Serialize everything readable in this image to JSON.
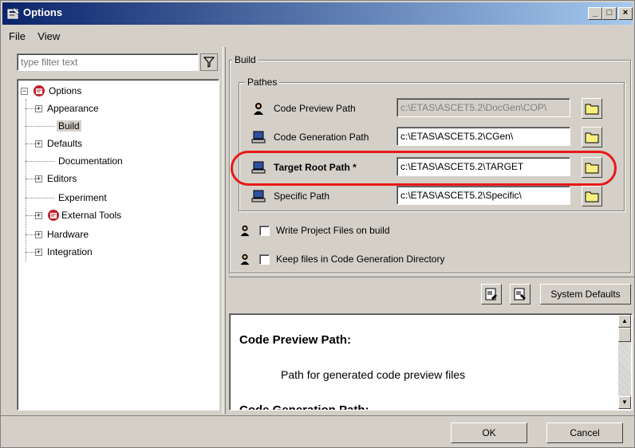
{
  "window": {
    "title": "Options",
    "controls": {
      "minimize": "_",
      "maximize": "□",
      "close": "×"
    }
  },
  "menu": [
    "File",
    "View"
  ],
  "filter": {
    "placeholder": "type filter text",
    "icon": "filter-icon"
  },
  "tree": {
    "root": "Options",
    "items": [
      {
        "label": "Appearance",
        "expandable": true
      },
      {
        "label": "Build",
        "expandable": false,
        "selected": true
      },
      {
        "label": "Defaults",
        "expandable": true
      },
      {
        "label": "Documentation",
        "expandable": false
      },
      {
        "label": "Editors",
        "expandable": true
      },
      {
        "label": "Experiment",
        "expandable": false
      },
      {
        "label": "External Tools",
        "expandable": true
      },
      {
        "label": "Hardware",
        "expandable": true
      },
      {
        "label": "Integration",
        "expandable": true
      }
    ]
  },
  "build": {
    "group_label": "Build",
    "pathes_label": "Pathes",
    "paths": [
      {
        "label": "Code Preview Path",
        "value": "c:\\ETAS\\ASCET5.2\\DocGen\\COP\\",
        "disabled": true,
        "bold": false
      },
      {
        "label": "Code Generation Path",
        "value": "c:\\ETAS\\ASCET5.2\\CGen\\",
        "disabled": false,
        "bold": false
      },
      {
        "label": "Target Root Path *",
        "value": "c:\\ETAS\\ASCET5.2\\TARGET",
        "disabled": false,
        "bold": true
      },
      {
        "label": "Specific Path",
        "value": "c:\\ETAS\\ASCET5.2\\Specific\\",
        "disabled": false,
        "bold": false
      }
    ],
    "checkboxes": [
      {
        "label": "Write Project Files on build",
        "checked": false
      },
      {
        "label": "Keep files in Code Generation Directory",
        "checked": false
      }
    ]
  },
  "actions": {
    "system_defaults": "System Defaults"
  },
  "help": {
    "heading1": "Code Preview Path:",
    "text1": "Path for generated code preview files",
    "heading2": "Code Generation Path:"
  },
  "buttons": {
    "ok": "OK",
    "cancel": "Cancel"
  },
  "colors": {
    "title_start": "#0a246a",
    "title_end": "#a6caf0",
    "highlight": "#e8181a",
    "folder": "#f7f080"
  }
}
